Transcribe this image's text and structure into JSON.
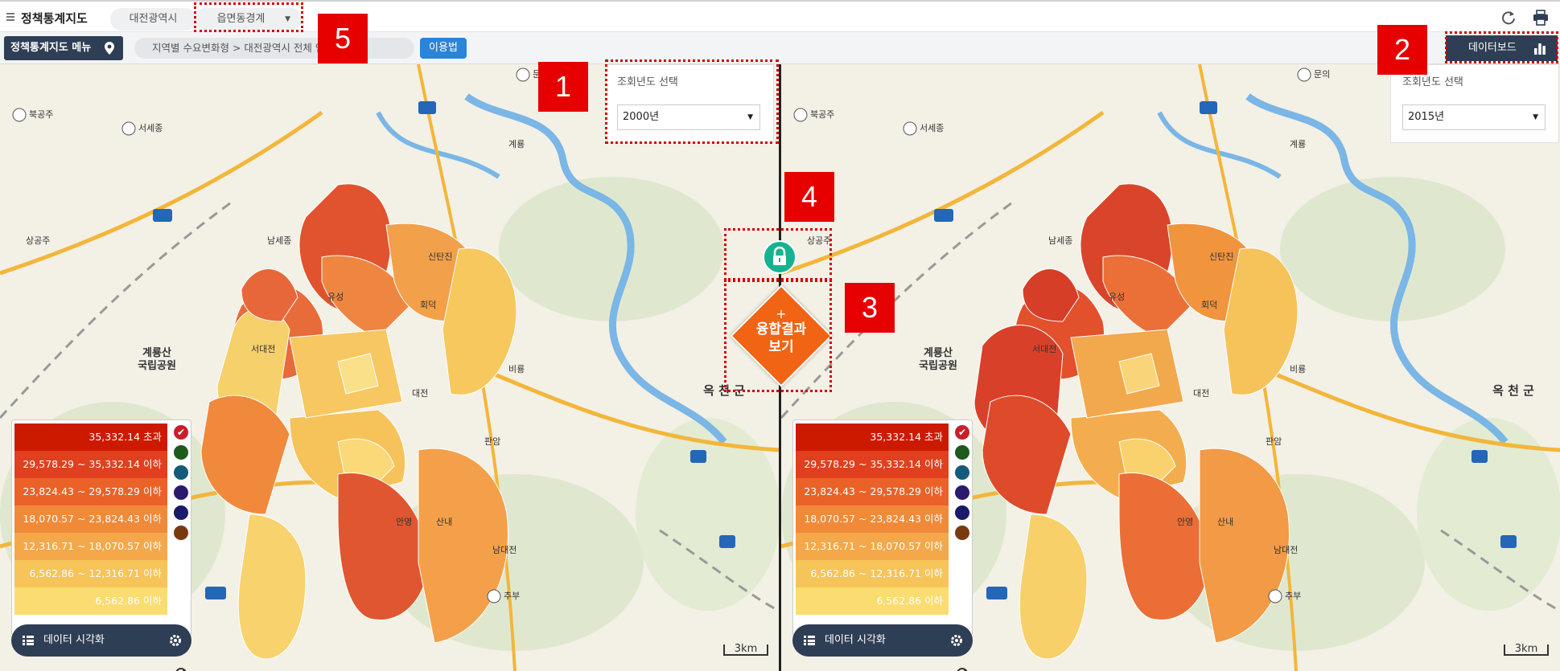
{
  "header": {
    "app_title": "정책통계지도",
    "region_pill": "대전광역시",
    "boundary_pill": "읍면동경계"
  },
  "subbar": {
    "menu_label": "정책통계지도 메뉴",
    "breadcrumb": "지역별 수요변화형 > 대전광역시 전체 인구의 변화",
    "howto_label": "이용법",
    "dashboard_label": "데이터보드"
  },
  "left_map": {
    "year_label": "조회년도 선택",
    "year_value": "2000년",
    "scale_label": "3km"
  },
  "right_map": {
    "year_label": "조회년도 선택",
    "year_value": "2015년",
    "scale_label": "3km"
  },
  "legend": {
    "ranges": [
      "35,332.14 초과",
      "29,578.29 ~ 35,332.14 이하",
      "23,824.43 ~ 29,578.29 이하",
      "18,070.57 ~ 23,824.43 이하",
      "12,316.71 ~ 18,070.57 이하",
      "6,562.86 ~ 12,316.71 이하",
      "6,562.86 이하"
    ],
    "range_colors": [
      "#cc1a00",
      "#e0401e",
      "#ea6228",
      "#f08a38",
      "#f4a84a",
      "#f6c458",
      "#fbdc70"
    ],
    "theme_colors": [
      "#c8202a",
      "#1e5a1e",
      "#155a7a",
      "#2a1a6e",
      "#1a1a6a",
      "#7a3a10"
    ],
    "viz_label": "데이터 시각화"
  },
  "fusion": {
    "plus": "+",
    "line1": "융합결과",
    "line2": "보기"
  },
  "map_labels": {
    "park": "계룡산\n국립공원",
    "okcheon": "옥 천 군",
    "places": [
      "북공주",
      "서세종",
      "상공주",
      "남세종",
      "유성",
      "서대전",
      "안영",
      "산내",
      "남대전",
      "추부",
      "비룡",
      "판암",
      "회덕",
      "신탄진",
      "대전",
      "계룡",
      "문의"
    ]
  },
  "annotations": [
    "1",
    "2",
    "3",
    "4",
    "5"
  ]
}
